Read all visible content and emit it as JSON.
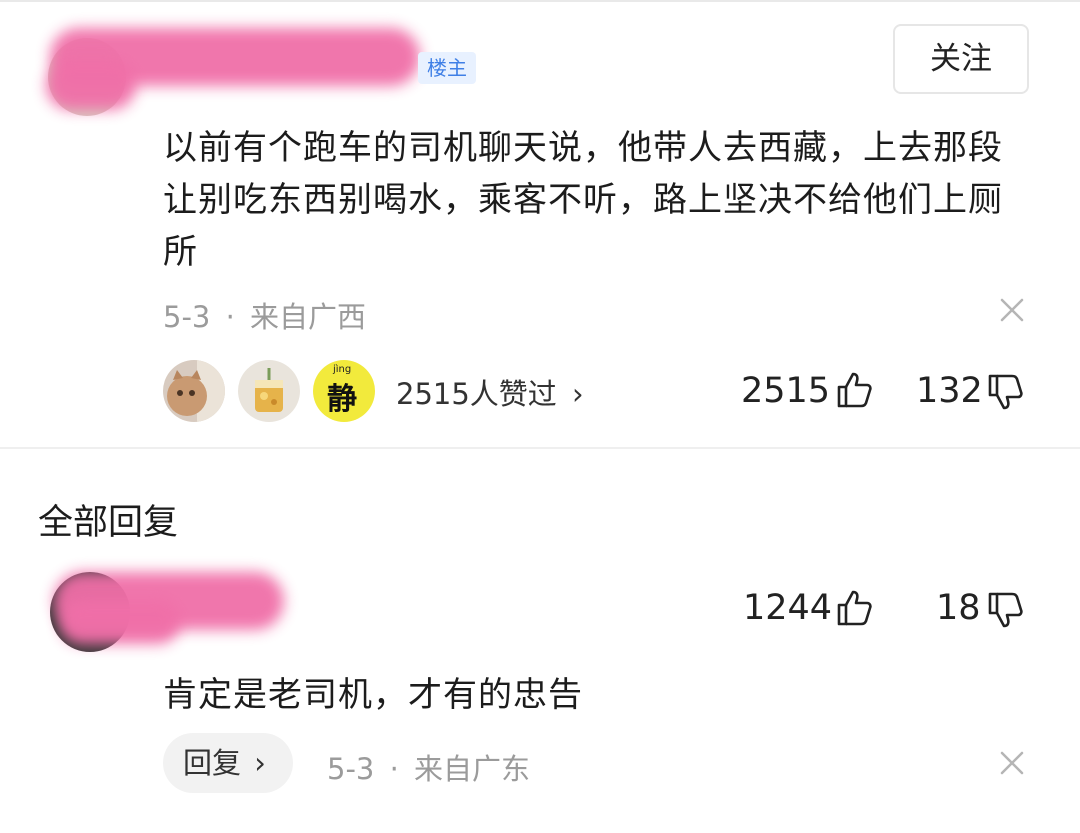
{
  "post": {
    "op_badge": "楼主",
    "follow_label": "关注",
    "content": "以前有个跑车的司机聊天说，他带人去西藏，上去那段让别吃东西别喝水，乘客不听，路上坚决不给他们上厕所",
    "date": "5-3",
    "separator": "·",
    "location": "来自广西",
    "liked_by_text": "2515人赞过",
    "liked_by_chevron": "›",
    "like_count": "2515",
    "dislike_count": "132",
    "liker_avatar_3_char": "静",
    "liker_avatar_3_pinyin": "jìng"
  },
  "section_title": "全部回复",
  "reply": {
    "like_count": "1244",
    "dislike_count": "18",
    "content": "肯定是老司机，才有的忠告",
    "reply_label": "回复",
    "reply_chevron": "›",
    "date": "5-3",
    "separator": "·",
    "location": "来自广东"
  },
  "colors": {
    "redaction_pink": "#f06fa8",
    "badge_blue": "#3f7fe6",
    "badge_bg": "#e8f1ff",
    "meta_gray": "#9b9b9b"
  }
}
